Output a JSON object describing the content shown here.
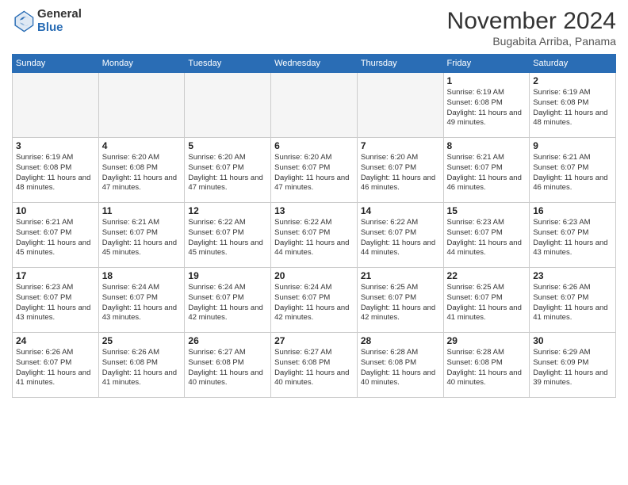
{
  "header": {
    "logo_general": "General",
    "logo_blue": "Blue",
    "month_title": "November 2024",
    "subtitle": "Bugabita Arriba, Panama"
  },
  "days_of_week": [
    "Sunday",
    "Monday",
    "Tuesday",
    "Wednesday",
    "Thursday",
    "Friday",
    "Saturday"
  ],
  "weeks": [
    [
      {
        "day": "",
        "info": ""
      },
      {
        "day": "",
        "info": ""
      },
      {
        "day": "",
        "info": ""
      },
      {
        "day": "",
        "info": ""
      },
      {
        "day": "",
        "info": ""
      },
      {
        "day": "1",
        "info": "Sunrise: 6:19 AM\nSunset: 6:08 PM\nDaylight: 11 hours and 49 minutes."
      },
      {
        "day": "2",
        "info": "Sunrise: 6:19 AM\nSunset: 6:08 PM\nDaylight: 11 hours and 48 minutes."
      }
    ],
    [
      {
        "day": "3",
        "info": "Sunrise: 6:19 AM\nSunset: 6:08 PM\nDaylight: 11 hours and 48 minutes."
      },
      {
        "day": "4",
        "info": "Sunrise: 6:20 AM\nSunset: 6:08 PM\nDaylight: 11 hours and 47 minutes."
      },
      {
        "day": "5",
        "info": "Sunrise: 6:20 AM\nSunset: 6:07 PM\nDaylight: 11 hours and 47 minutes."
      },
      {
        "day": "6",
        "info": "Sunrise: 6:20 AM\nSunset: 6:07 PM\nDaylight: 11 hours and 47 minutes."
      },
      {
        "day": "7",
        "info": "Sunrise: 6:20 AM\nSunset: 6:07 PM\nDaylight: 11 hours and 46 minutes."
      },
      {
        "day": "8",
        "info": "Sunrise: 6:21 AM\nSunset: 6:07 PM\nDaylight: 11 hours and 46 minutes."
      },
      {
        "day": "9",
        "info": "Sunrise: 6:21 AM\nSunset: 6:07 PM\nDaylight: 11 hours and 46 minutes."
      }
    ],
    [
      {
        "day": "10",
        "info": "Sunrise: 6:21 AM\nSunset: 6:07 PM\nDaylight: 11 hours and 45 minutes."
      },
      {
        "day": "11",
        "info": "Sunrise: 6:21 AM\nSunset: 6:07 PM\nDaylight: 11 hours and 45 minutes."
      },
      {
        "day": "12",
        "info": "Sunrise: 6:22 AM\nSunset: 6:07 PM\nDaylight: 11 hours and 45 minutes."
      },
      {
        "day": "13",
        "info": "Sunrise: 6:22 AM\nSunset: 6:07 PM\nDaylight: 11 hours and 44 minutes."
      },
      {
        "day": "14",
        "info": "Sunrise: 6:22 AM\nSunset: 6:07 PM\nDaylight: 11 hours and 44 minutes."
      },
      {
        "day": "15",
        "info": "Sunrise: 6:23 AM\nSunset: 6:07 PM\nDaylight: 11 hours and 44 minutes."
      },
      {
        "day": "16",
        "info": "Sunrise: 6:23 AM\nSunset: 6:07 PM\nDaylight: 11 hours and 43 minutes."
      }
    ],
    [
      {
        "day": "17",
        "info": "Sunrise: 6:23 AM\nSunset: 6:07 PM\nDaylight: 11 hours and 43 minutes."
      },
      {
        "day": "18",
        "info": "Sunrise: 6:24 AM\nSunset: 6:07 PM\nDaylight: 11 hours and 43 minutes."
      },
      {
        "day": "19",
        "info": "Sunrise: 6:24 AM\nSunset: 6:07 PM\nDaylight: 11 hours and 42 minutes."
      },
      {
        "day": "20",
        "info": "Sunrise: 6:24 AM\nSunset: 6:07 PM\nDaylight: 11 hours and 42 minutes."
      },
      {
        "day": "21",
        "info": "Sunrise: 6:25 AM\nSunset: 6:07 PM\nDaylight: 11 hours and 42 minutes."
      },
      {
        "day": "22",
        "info": "Sunrise: 6:25 AM\nSunset: 6:07 PM\nDaylight: 11 hours and 41 minutes."
      },
      {
        "day": "23",
        "info": "Sunrise: 6:26 AM\nSunset: 6:07 PM\nDaylight: 11 hours and 41 minutes."
      }
    ],
    [
      {
        "day": "24",
        "info": "Sunrise: 6:26 AM\nSunset: 6:07 PM\nDaylight: 11 hours and 41 minutes."
      },
      {
        "day": "25",
        "info": "Sunrise: 6:26 AM\nSunset: 6:08 PM\nDaylight: 11 hours and 41 minutes."
      },
      {
        "day": "26",
        "info": "Sunrise: 6:27 AM\nSunset: 6:08 PM\nDaylight: 11 hours and 40 minutes."
      },
      {
        "day": "27",
        "info": "Sunrise: 6:27 AM\nSunset: 6:08 PM\nDaylight: 11 hours and 40 minutes."
      },
      {
        "day": "28",
        "info": "Sunrise: 6:28 AM\nSunset: 6:08 PM\nDaylight: 11 hours and 40 minutes."
      },
      {
        "day": "29",
        "info": "Sunrise: 6:28 AM\nSunset: 6:08 PM\nDaylight: 11 hours and 40 minutes."
      },
      {
        "day": "30",
        "info": "Sunrise: 6:29 AM\nSunset: 6:09 PM\nDaylight: 11 hours and 39 minutes."
      }
    ]
  ]
}
